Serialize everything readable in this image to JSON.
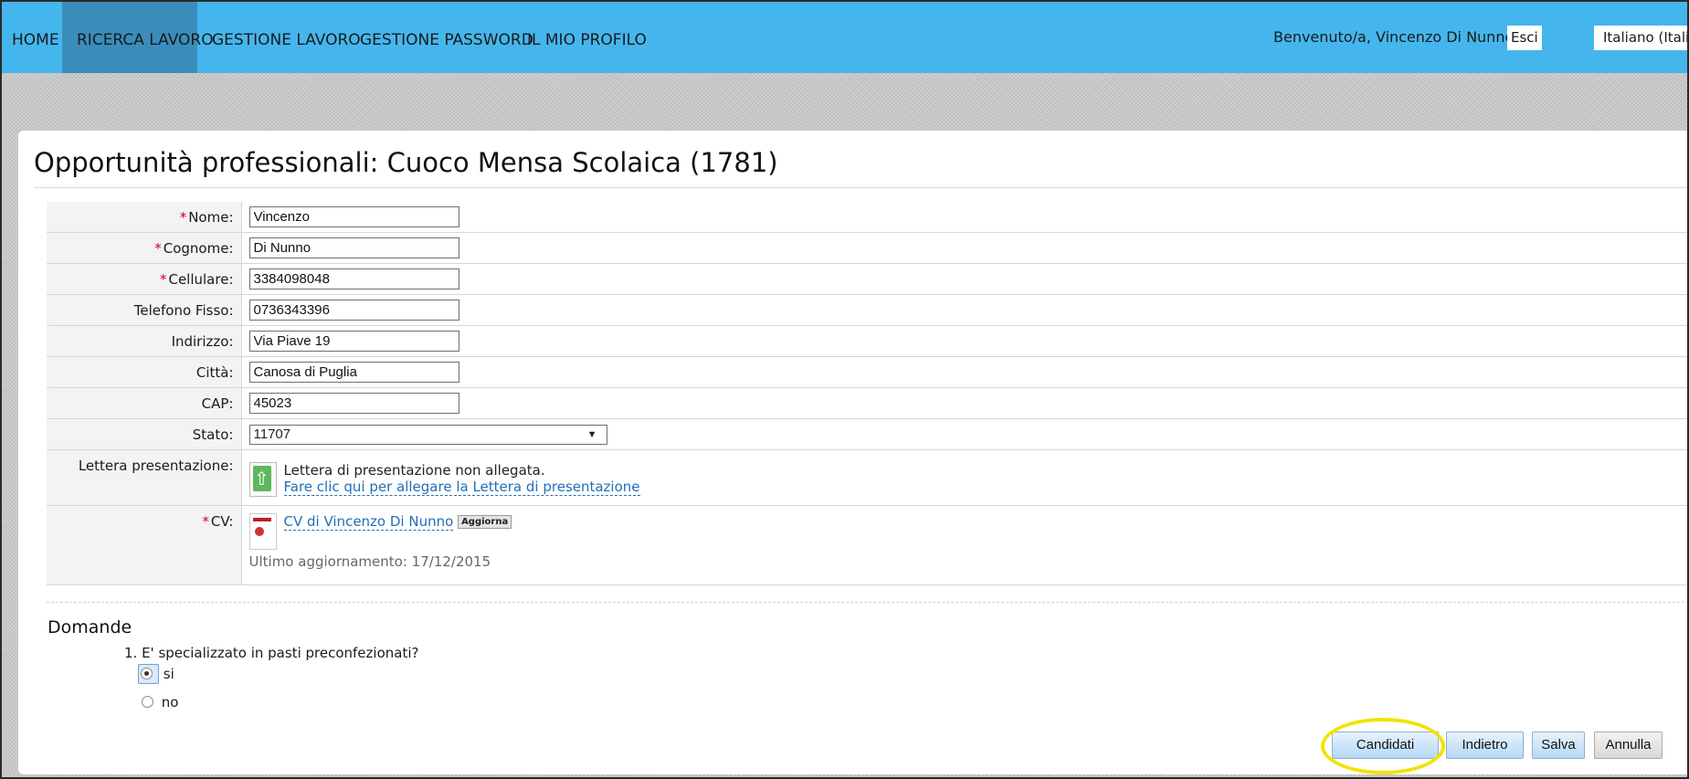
{
  "nav": {
    "items": [
      {
        "label": "HOME",
        "active": false
      },
      {
        "label": "RICERCA LAVORO",
        "active": true
      },
      {
        "label": "GESTIONE LAVORO",
        "active": false
      },
      {
        "label": "GESTIONE PASSWORD",
        "active": false
      },
      {
        "label": "IL MIO PROFILO",
        "active": false
      }
    ],
    "welcome": "Benvenuto/a, Vincenzo Di Nunno",
    "logout": "Esci",
    "language": "Italiano (Italian"
  },
  "page": {
    "title": "Opportunità professionali: Cuoco Mensa Scolaica (1781)"
  },
  "form": {
    "nome": {
      "label": "Nome:",
      "value": "Vincenzo"
    },
    "cognome": {
      "label": "Cognome:",
      "value": "Di Nunno"
    },
    "cellulare": {
      "label": "Cellulare:",
      "value": "3384098048"
    },
    "telefono": {
      "label": "Telefono Fisso:",
      "value": "0736343396"
    },
    "indirizzo": {
      "label": "Indirizzo:",
      "value": "Via Piave 19"
    },
    "citta": {
      "label": "Città:",
      "value": "Canosa di Puglia"
    },
    "cap": {
      "label": "CAP:",
      "value": "45023"
    },
    "stato": {
      "label": "Stato:",
      "value": "11707"
    },
    "lettera": {
      "label": "Lettera presentazione:",
      "status": "Lettera di presentazione non allegata.",
      "link": "Fare clic qui per allegare la Lettera di presentazione"
    },
    "cv": {
      "label": "CV:",
      "link": "CV di Vincenzo Di Nunno",
      "update_button": "Aggiorna",
      "last_update": "Ultimo aggiornamento: 17/12/2015"
    }
  },
  "domande": {
    "title": "Domande",
    "questions": [
      {
        "text": "1. E' specializzato in pasti preconfezionati?",
        "options": [
          {
            "label": "si",
            "selected": true
          },
          {
            "label": "no",
            "selected": false
          }
        ]
      }
    ]
  },
  "buttons": {
    "candidati": "Candidati",
    "indietro": "Indietro",
    "salva": "Salva",
    "annulla": "Annulla"
  },
  "colors": {
    "topbar": "#45b6ed",
    "active_nav": "#3a8dbb",
    "required": "#d0021b",
    "highlight": "#f3e300"
  }
}
